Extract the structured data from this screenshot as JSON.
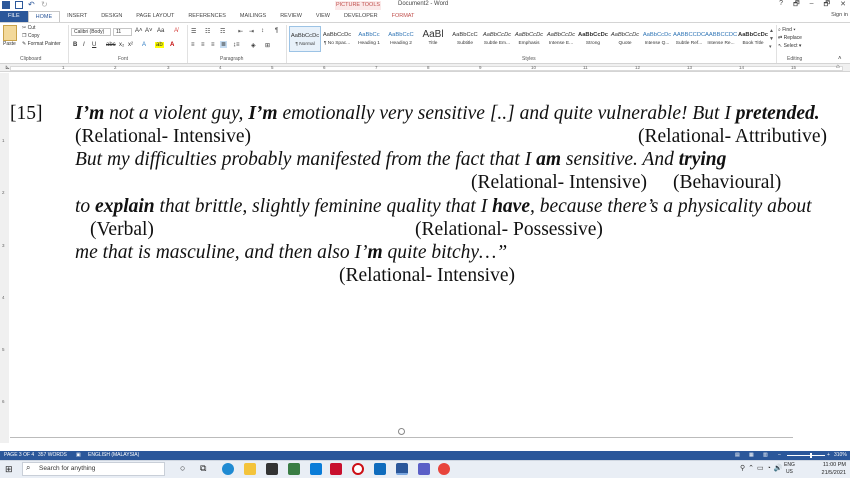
{
  "window": {
    "doc_title": "Document2 - Word",
    "picture_tools": "PICTURE TOOLS",
    "sign_in": "Sign in",
    "controls": [
      "?",
      "🗗",
      "–",
      "🗗",
      "✕"
    ]
  },
  "tabs": [
    "FILE",
    "HOME",
    "INSERT",
    "DESIGN",
    "PAGE LAYOUT",
    "REFERENCES",
    "MAILINGS",
    "REVIEW",
    "VIEW",
    "DEVELOPER",
    "FORMAT"
  ],
  "ribbon": {
    "clipboard": {
      "paste": "Paste",
      "cut": "Cut",
      "copy": "Copy",
      "format_painter": "Format Painter",
      "label": "Clipboard"
    },
    "font": {
      "name": "Calibri (Body)",
      "size": "11",
      "label": "Font"
    },
    "paragraph": {
      "label": "Paragraph"
    },
    "styles": {
      "label": "Styles",
      "items": [
        {
          "preview": "AaBbCcDc",
          "name": "¶ Normal"
        },
        {
          "preview": "AaBbCcDc",
          "name": "¶ No Spac..."
        },
        {
          "preview": "AaBbCc",
          "name": "Heading 1"
        },
        {
          "preview": "AaBbCcC",
          "name": "Heading 2"
        },
        {
          "preview": "AaBl",
          "name": "Title"
        },
        {
          "preview": "AaBbCcC",
          "name": "Subtitle"
        },
        {
          "preview": "AaBbCcDc",
          "name": "Subtle Em..."
        },
        {
          "preview": "AaBbCcDc",
          "name": "Emphasis"
        },
        {
          "preview": "AaBbCcDc",
          "name": "Intense E..."
        },
        {
          "preview": "AaBbCcDc",
          "name": "Strong"
        },
        {
          "preview": "AaBbCcDc",
          "name": "Quote"
        },
        {
          "preview": "AaBbCcDc",
          "name": "Intense Q..."
        },
        {
          "preview": "AABBCCDC",
          "name": "Subtle Ref..."
        },
        {
          "preview": "AABBCCDC",
          "name": "Intense Re..."
        },
        {
          "preview": "AaBbCcDc",
          "name": "Book Title"
        }
      ]
    },
    "editing": {
      "find": "Find",
      "replace": "Replace",
      "select": "Select",
      "label": "Editing"
    }
  },
  "ruler_numbers": [
    "1",
    "2",
    "3",
    "4",
    "5",
    "6",
    "7",
    "8",
    "9",
    "10",
    "11",
    "12",
    "13",
    "14",
    "15"
  ],
  "vruler_numbers": [
    "1",
    "2",
    "3",
    "4",
    "5",
    "6"
  ],
  "document": {
    "lines": [
      {
        "spans": [
          {
            "t": "[15]",
            "s": "n"
          }
        ]
      },
      {
        "spans": [
          {
            "t": "I’m",
            "s": "bi"
          },
          {
            "t": " not a violent guy, ",
            "s": "it"
          },
          {
            "t": "I’m",
            "s": "bi"
          },
          {
            "t": " emotionally very sensitive [..] and quite vulnerable! But I ",
            "s": "it"
          },
          {
            "t": "pretended.",
            "s": "bi"
          }
        ]
      },
      {
        "spans": [
          {
            "t": "(Relational- Intensive)",
            "s": "n"
          }
        ]
      },
      {
        "spans": [
          {
            "t": "(Relational- Attributive)",
            "s": "n"
          }
        ]
      },
      {
        "spans": [
          {
            "t": "But my difficulties probably manifested from the fact that I ",
            "s": "it"
          },
          {
            "t": "am",
            "s": "bi"
          },
          {
            "t": " sensitive. And ",
            "s": "it"
          },
          {
            "t": "trying",
            "s": "bi"
          }
        ]
      },
      {
        "spans": [
          {
            "t": "(Relational- Intensive)",
            "s": "n"
          }
        ]
      },
      {
        "spans": [
          {
            "t": "(Behavioural)",
            "s": "n"
          }
        ]
      },
      {
        "spans": [
          {
            "t": "to ",
            "s": "it"
          },
          {
            "t": "explain",
            "s": "bi"
          },
          {
            "t": " that brittle, slightly feminine quality that I ",
            "s": "it"
          },
          {
            "t": "have",
            "s": "bi"
          },
          {
            "t": ", because there’s a physicality about",
            "s": "it"
          }
        ]
      },
      {
        "spans": [
          {
            "t": "(Verbal)",
            "s": "n"
          }
        ]
      },
      {
        "spans": [
          {
            "t": "(Relational- Possessive)",
            "s": "n"
          }
        ]
      },
      {
        "spans": [
          {
            "t": "me that is masculine, and then also I’",
            "s": "it"
          },
          {
            "t": "m",
            "s": "bi"
          },
          {
            "t": " quite bitchy…”",
            "s": "it"
          }
        ]
      },
      {
        "spans": [
          {
            "t": "(Relational- Intensive)",
            "s": "n"
          }
        ]
      }
    ]
  },
  "status_bar": {
    "page": "PAGE 3 OF 4",
    "words": "357 WORDS",
    "language": "ENGLISH (MALAYSIA)",
    "zoom": "310%"
  },
  "taskbar": {
    "search_placeholder": "Search for anything",
    "lang": "ENG",
    "region": "US",
    "time": "11:00 PM",
    "date": "21/5/2021"
  },
  "colors": {
    "word_blue": "#2b579a",
    "picture_tools": "#c0504d"
  }
}
